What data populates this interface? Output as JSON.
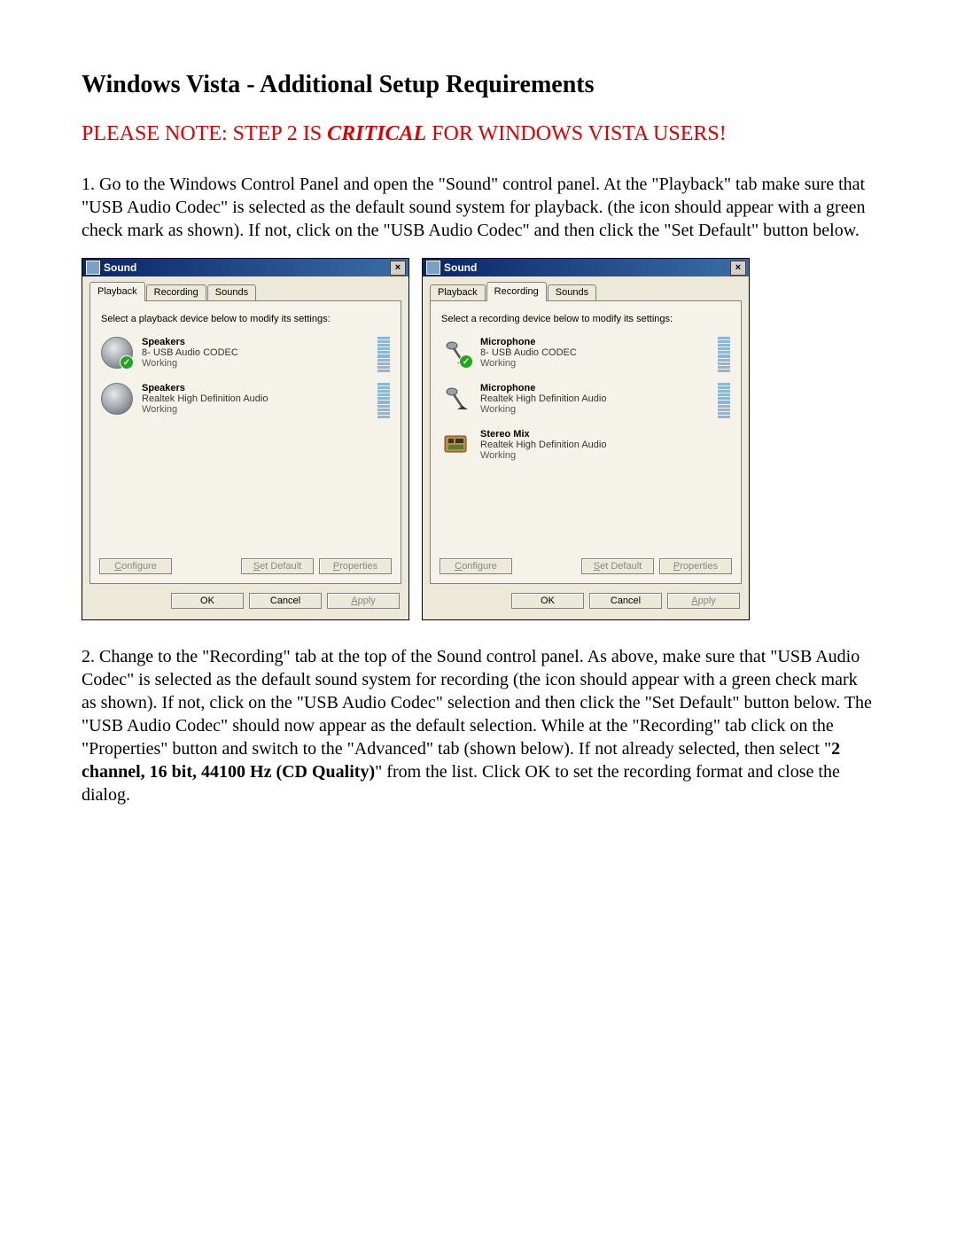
{
  "heading": "Windows Vista - Additional Setup Requirements",
  "note_prefix": "PLEASE NOTE: STEP 2 IS ",
  "note_critical": "CRITICAL",
  "note_suffix": " FOR WINDOWS VISTA USERS!",
  "step1": "1. Go to the Windows Control Panel and open the \"Sound\" control panel. At the \"Playback\" tab make sure that \"USB Audio Codec\" is selected as the default sound system for playback. (the icon should appear with a green check mark as shown). If not, click on the \"USB Audio Codec\" and then click the \"Set Default\" button below.",
  "step2_a": "2. Change to the \"Recording\" tab at the top of the Sound control panel. As above, make sure that \"USB Audio Codec\" is selected as the default sound system for recording (the icon should appear with a green check mark as shown). If not, click on the \"USB Audio Codec\" selection and then click the \"Set Default\" button below. The \"USB Audio Codec\" should now appear as the default selection. While at the \"Recording\" tab click on the \"Properties\" button and switch to the \"Advanced\" tab (shown below). If not already selected, then select \"",
  "step2_bold": "2 channel, 16 bit, 44100 Hz (CD Quality)",
  "step2_b": "\" from the list. Click OK to set the recording format and close the dialog.",
  "dialog": {
    "title": "Sound",
    "close_x": "×",
    "tabs": {
      "playback": "Playback",
      "recording": "Recording",
      "sounds": "Sounds"
    },
    "playback_instruct": "Select a playback device below to modify its settings:",
    "recording_instruct": "Select a recording device below to modify its settings:",
    "buttons": {
      "configure": "Configure",
      "configure_u": "C",
      "setdefault": "Set Default",
      "setdefault_u": "S",
      "properties": "Properties",
      "properties_u": "P",
      "ok": "OK",
      "cancel": "Cancel",
      "apply": "Apply",
      "apply_u": "A"
    },
    "playback_devices": [
      {
        "name": "Speakers",
        "sub": "8- USB Audio CODEC",
        "status": "Working",
        "default": true
      },
      {
        "name": "Speakers",
        "sub": "Realtek High Definition Audio",
        "status": "Working",
        "default": false
      }
    ],
    "recording_devices": [
      {
        "name": "Microphone",
        "sub": "8- USB Audio CODEC",
        "status": "Working",
        "default": true,
        "icon": "mic"
      },
      {
        "name": "Microphone",
        "sub": "Realtek High Definition Audio",
        "status": "Working",
        "default": false,
        "icon": "mic"
      },
      {
        "name": "Stereo Mix",
        "sub": "Realtek High Definition Audio",
        "status": "Working",
        "default": false,
        "icon": "board"
      }
    ]
  }
}
